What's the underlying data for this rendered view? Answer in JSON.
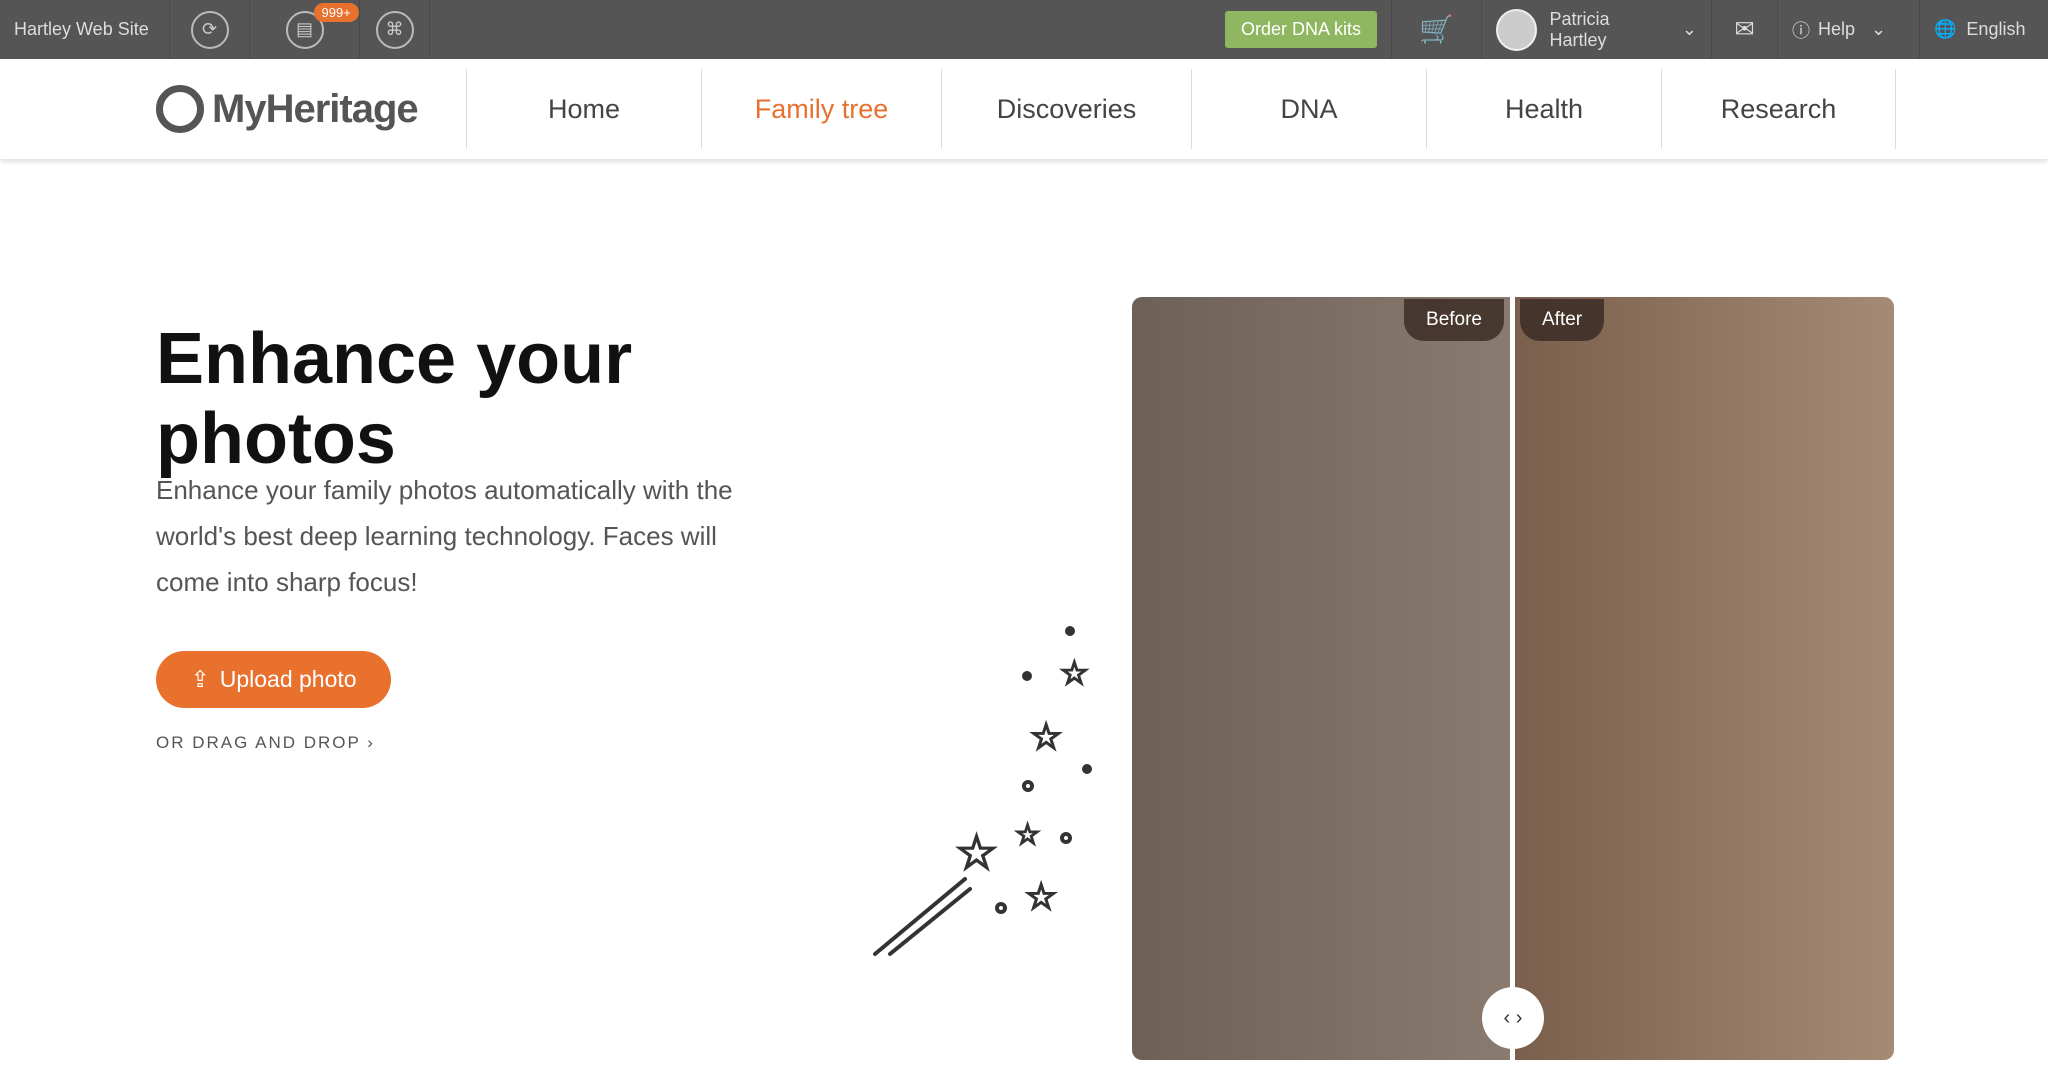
{
  "topbar": {
    "site": "Hartley Web Site",
    "badge": "999+",
    "order": "Order DNA kits",
    "user": "Patricia Hartley",
    "help": "Help",
    "language": "English"
  },
  "nav": {
    "logo": "MyHeritage",
    "items": [
      "Home",
      "Family tree",
      "Discoveries",
      "DNA",
      "Health",
      "Research"
    ],
    "active": "Family tree"
  },
  "hero": {
    "title": "Enhance your photos",
    "desc": "Enhance your family photos automatically with the world's best deep learning technology. Faces will come into sharp focus!",
    "upload": "Upload photo",
    "drag": "OR DRAG AND DROP",
    "before": "Before",
    "after": "After"
  },
  "colors": {
    "accent": "#e8712e",
    "green": "#8fb660",
    "topbar": "#555555"
  }
}
